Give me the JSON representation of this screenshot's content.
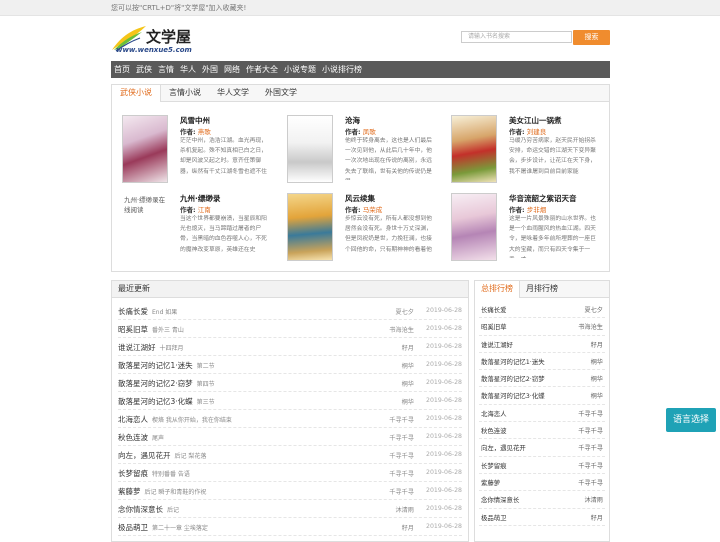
{
  "topbar": {
    "notice": "您可以按\"CRTL+D\"将\"文学屋\"加入收藏夹!"
  },
  "logo": {
    "name": "文学屋",
    "url": "www.wenxue5.com"
  },
  "search": {
    "placeholder": "请输入书名搜索",
    "button": "搜索"
  },
  "nav": [
    "首页",
    "武侠",
    "言情",
    "华人",
    "外国",
    "网络",
    "作者大全",
    "小说专题",
    "小说排行榜"
  ],
  "featured": {
    "tabs": [
      "武侠小说",
      "言情小说",
      "华人文学",
      "外国文学"
    ],
    "author_label": "作者:",
    "books": [
      {
        "title": "风雪中州",
        "author": "燕歌",
        "desc": "茫茫中州，浩浩江湖。血光再现，杀机复起。殊不知真相已白之日，却是风波又起之时。意齐任策御器，纵然有千丈江湖冬雪也遮不住"
      },
      {
        "title": "沧海",
        "author": "凤歌",
        "desc": "他终于转身离去，这也是人们最后一次见到他，从此后几十年中，他一次次地出现在传说的离别，永远失去了联络，世有关他的传说仍是很"
      },
      {
        "title": "美女江山一锅煮",
        "author": "刘建良",
        "desc": "马缓乃穷苦病家，赵天民开始拐杀安排，命运交错的江湖天下变异聚会，步步设计，让花江在天下身，我不屠谁屠到目前目前家能"
      },
      {
        "title": "九州·缥缈录",
        "author": "江南",
        "desc": "当这个世界都要崩溃，当星辰和阳光也熄灭，当马蹄踏过屠者的尸骨，当黑暗的血色吞噬人心，不死的魔神改变草原，英雄还在史"
      },
      {
        "title": "风云续集",
        "author": "马荣成",
        "desc": "步惊云没有死，所有人都没想到他居然会没有死。身世十万丈深渊，但是凤祝奶是世，力挽狂澜，也接个回他的命，只有期神神的看着他"
      },
      {
        "title": "华音流韶之紫诏天音",
        "author": "步非烟",
        "desc": "这是一片风景殊丽的山水世界。也是一个血雨腥风的热血江湖。四天令，是咏着多年前所埋葬的一座巨大的宝藏，而只有四天令集于一手，才"
      }
    ],
    "broken_cover_alt": "九州·缥缈录在线阅读"
  },
  "latest": {
    "title": "最近更新",
    "rows": [
      {
        "title": "长痛长爱",
        "chapter": "End 如果",
        "author": "夏七夕",
        "date": "2019-06-28"
      },
      {
        "title": "昭奚旧草",
        "chapter": "番外三 青山",
        "author": "书海沧生",
        "date": "2019-06-28"
      },
      {
        "title": "谁说江湖好",
        "chapter": "十四拜月",
        "author": "籽月",
        "date": "2019-06-28"
      },
      {
        "title": "散落星河的记忆1·迷失",
        "chapter": "第二节",
        "author": "桐华",
        "date": "2019-06-28"
      },
      {
        "title": "散落星河的记忆2·窃梦",
        "chapter": "第四节",
        "author": "桐华",
        "date": "2019-06-28"
      },
      {
        "title": "散落星河的记忆3·化蝶",
        "chapter": "第三节",
        "author": "桐华",
        "date": "2019-06-28"
      },
      {
        "title": "北海恋人",
        "chapter": "楔烙 我从你开始，我在你结束",
        "author": "千寻千寻",
        "date": "2019-06-28"
      },
      {
        "title": "秋色连波",
        "chapter": "尾声",
        "author": "千寻千寻",
        "date": "2019-06-28"
      },
      {
        "title": "向左，遇见花开",
        "chapter": "后记 梨花落",
        "author": "千寻千寻",
        "date": "2019-06-28"
      },
      {
        "title": "长梦留痕",
        "chapter": "特别番番 告语",
        "author": "千寻千寻",
        "date": "2019-06-28"
      },
      {
        "title": "紫藤萝",
        "chapter": "后记 瞬子和青鞋的作祝",
        "author": "千寻千寻",
        "date": "2019-06-28"
      },
      {
        "title": "念你情深意长",
        "chapter": "后记",
        "author": "沐清雨",
        "date": "2019-06-28"
      },
      {
        "title": "极品萌卫",
        "chapter": "第二十一章 尘埃落定",
        "author": "籽月",
        "date": "2019-06-28"
      }
    ]
  },
  "ranking": {
    "tabs": [
      "总排行榜",
      "月排行榜"
    ],
    "rows": [
      {
        "title": "长痛长爱",
        "author": "夏七夕"
      },
      {
        "title": "昭奚旧草",
        "author": "书海沧生"
      },
      {
        "title": "谁说江湖好",
        "author": "籽月"
      },
      {
        "title": "散落星河的记忆1·迷失",
        "author": "桐华"
      },
      {
        "title": "散落星河的记忆2·窃梦",
        "author": "桐华"
      },
      {
        "title": "散落星河的记忆3·化蝶",
        "author": "桐华"
      },
      {
        "title": "北海恋人",
        "author": "千寻千寻"
      },
      {
        "title": "秋色连波",
        "author": "千寻千寻"
      },
      {
        "title": "向左，遇见花开",
        "author": "千寻千寻"
      },
      {
        "title": "长梦留痕",
        "author": "千寻千寻"
      },
      {
        "title": "紫藤萝",
        "author": "千寻千寻"
      },
      {
        "title": "念你情深意长",
        "author": "沐清雨"
      },
      {
        "title": "极品萌卫",
        "author": "籽月"
      }
    ]
  },
  "language_button": "语言选择",
  "colors": {
    "accent": "#f08c2e",
    "nav_bg": "#5a5a5a",
    "lang_btn": "#1fa2b6",
    "link_orange": "#e06a1a"
  }
}
